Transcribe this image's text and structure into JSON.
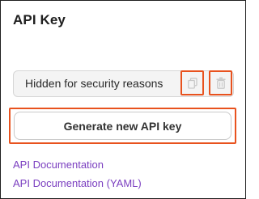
{
  "panel": {
    "title": "API Key"
  },
  "key_field": {
    "value": "Hidden for security reasons",
    "copy_icon": "copy-icon",
    "delete_icon": "trash-icon"
  },
  "actions": {
    "generate_label": "Generate new API key"
  },
  "links": [
    {
      "label": "API Documentation"
    },
    {
      "label": "API Documentation (YAML)"
    }
  ],
  "colors": {
    "highlight": "#e8521e",
    "link": "#7b3fc0",
    "icon_disabled": "#c9c9c9",
    "field_background": "#f4f4f4"
  }
}
